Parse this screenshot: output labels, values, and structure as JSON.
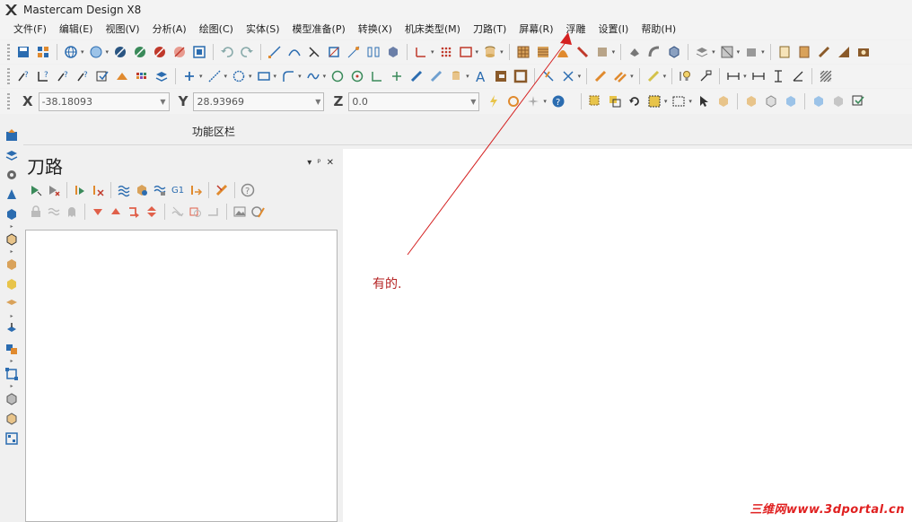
{
  "window": {
    "title": "Mastercam Design X8"
  },
  "menu": [
    "文件(F)",
    "编辑(E)",
    "视图(V)",
    "分析(A)",
    "绘图(C)",
    "实体(S)",
    "模型准备(P)",
    "转换(X)",
    "机床类型(M)",
    "刀路(T)",
    "屏幕(R)",
    "浮雕",
    "设置(I)",
    "帮助(H)"
  ],
  "coords": {
    "x_label": "X",
    "x_value": "-38.18093",
    "y_label": "Y",
    "y_value": "28.93969",
    "z_label": "Z",
    "z_value": "0.0"
  },
  "function_area": {
    "label": "功能区栏"
  },
  "panel": {
    "title": "刀路",
    "pin": "ᵖ",
    "close": "✕",
    "dropdown": "▾",
    "row1_label_g1": "G1"
  },
  "annotation": {
    "text": "有的."
  },
  "watermark": {
    "text": "三维网www.3dportal.cn"
  },
  "colors": {
    "accent_red": "#e02020",
    "annotation": "#b52424",
    "icon_blue": "#2b6cb0",
    "icon_orange": "#e08a2e"
  }
}
